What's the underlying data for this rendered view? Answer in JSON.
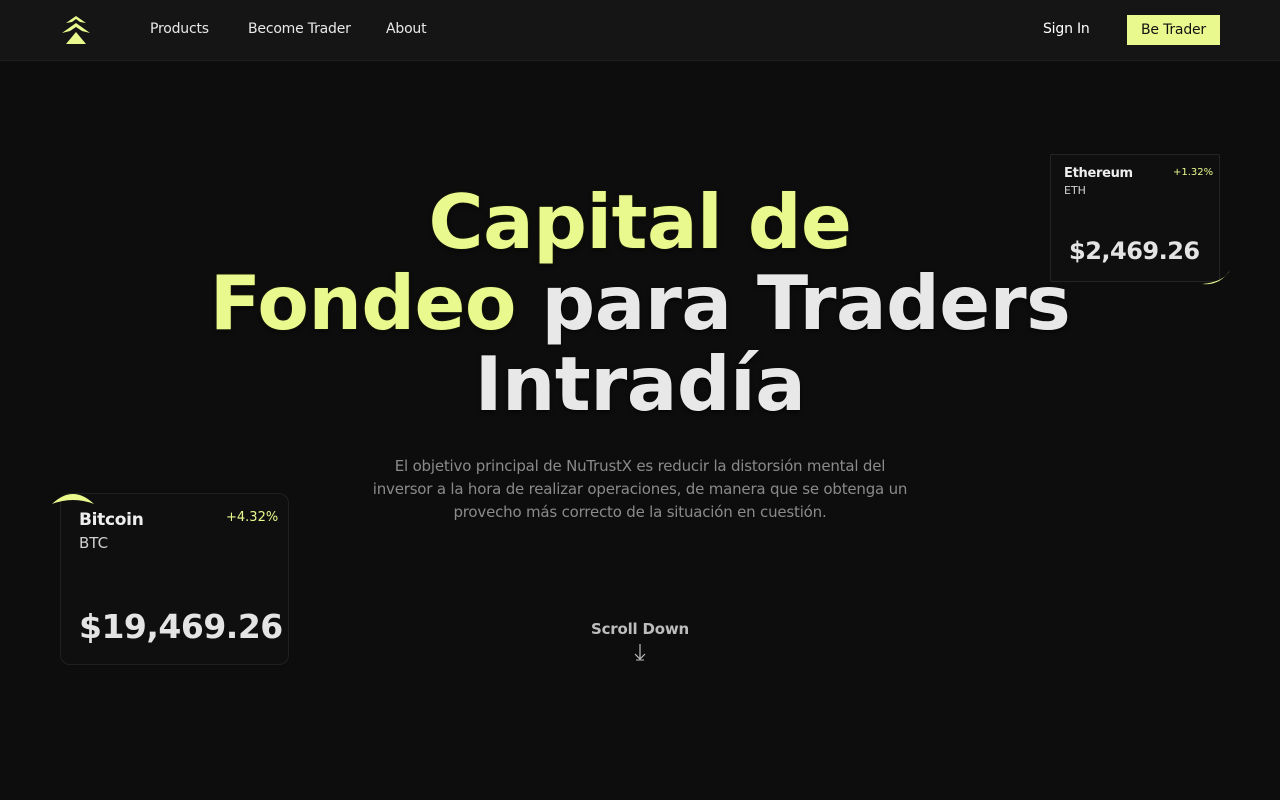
{
  "nav": {
    "logo_icon": "pine-tree-logo",
    "links": [
      "Products",
      "Become Trader",
      "About"
    ],
    "sign_in": "Sign In",
    "cta": "Be Trader"
  },
  "hero": {
    "line1": "Capital de",
    "line2_highlight": "Fondeo",
    "line2_rest": "para Traders",
    "line3": "Intradía",
    "subtitle": "El objetivo principal de NuTrustX es reducir la distorsión mental del inversor a la hora de realizar operaciones, de manera que se obtenga un provecho más correcto de la situación en cuestión.",
    "scroll_label": "Scroll Down"
  },
  "cards": {
    "eth": {
      "name": "Ethereum",
      "symbol": "ETH",
      "change": "+1.32%",
      "price": "$2,469.26"
    },
    "btc": {
      "name": "Bitcoin",
      "symbol": "BTC",
      "change": "+4.32%",
      "price": "$19,469.26"
    }
  },
  "colors": {
    "accent": "#eaf98d",
    "background": "#0d0d0d",
    "nav_background": "#151515"
  }
}
